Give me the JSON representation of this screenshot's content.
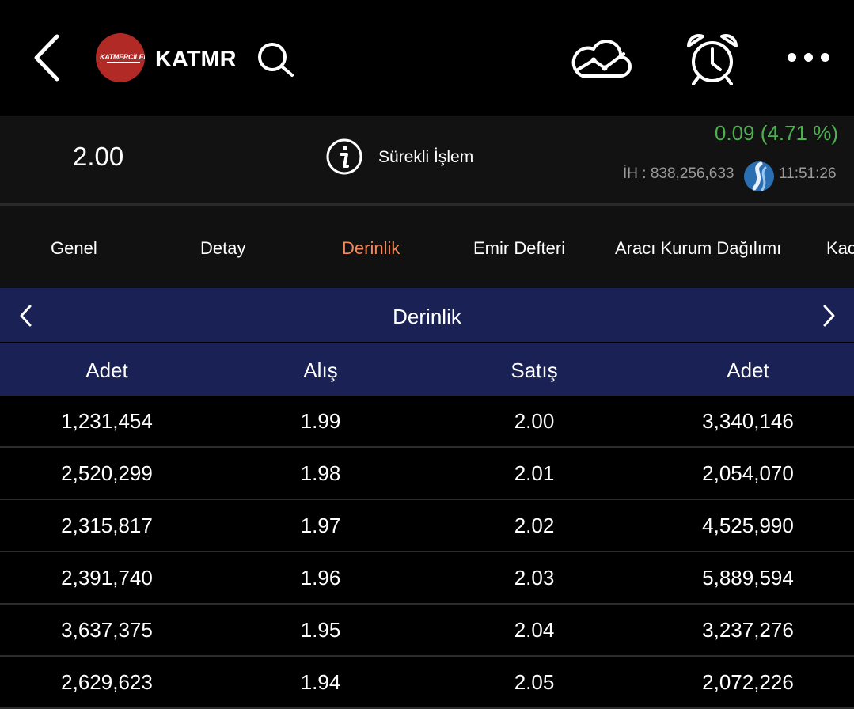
{
  "header": {
    "symbol": "KATMR",
    "logo_text": "KATMERCİLER",
    "icons": [
      "back-arrow-icon",
      "search-icon",
      "cloud-chart-icon",
      "alarm-clock-icon",
      "more-dots-icon"
    ]
  },
  "quote": {
    "price": "2.00",
    "session_label": "Sürekli İşlem",
    "change": "0.09 (4.71 %)",
    "volume": "İH : 838,256,633",
    "time": "11:51:26",
    "colors": {
      "up": "#4caf50",
      "muted": "#9a9a9a"
    }
  },
  "tabs": [
    {
      "label": "Genel",
      "active": false
    },
    {
      "label": "Detay",
      "active": false
    },
    {
      "label": "Derinlik",
      "active": true
    },
    {
      "label": "Emir Defteri",
      "active": false
    },
    {
      "label": "Aracı Kurum Dağılımı",
      "active": false
    },
    {
      "label": "Kac",
      "active": false
    }
  ],
  "accent_color": "#f08a5d",
  "depth": {
    "title": "Derinlik",
    "header_bg": "#1a2154",
    "columns": [
      "Adet",
      "Alış",
      "Satış",
      "Adet"
    ],
    "rows": [
      [
        "1,231,454",
        "1.99",
        "2.00",
        "3,340,146"
      ],
      [
        "2,520,299",
        "1.98",
        "2.01",
        "2,054,070"
      ],
      [
        "2,315,817",
        "1.97",
        "2.02",
        "4,525,990"
      ],
      [
        "2,391,740",
        "1.96",
        "2.03",
        "5,889,594"
      ],
      [
        "3,637,375",
        "1.95",
        "2.04",
        "3,237,276"
      ],
      [
        "2,629,623",
        "1.94",
        "2.05",
        "2,072,226"
      ]
    ]
  }
}
